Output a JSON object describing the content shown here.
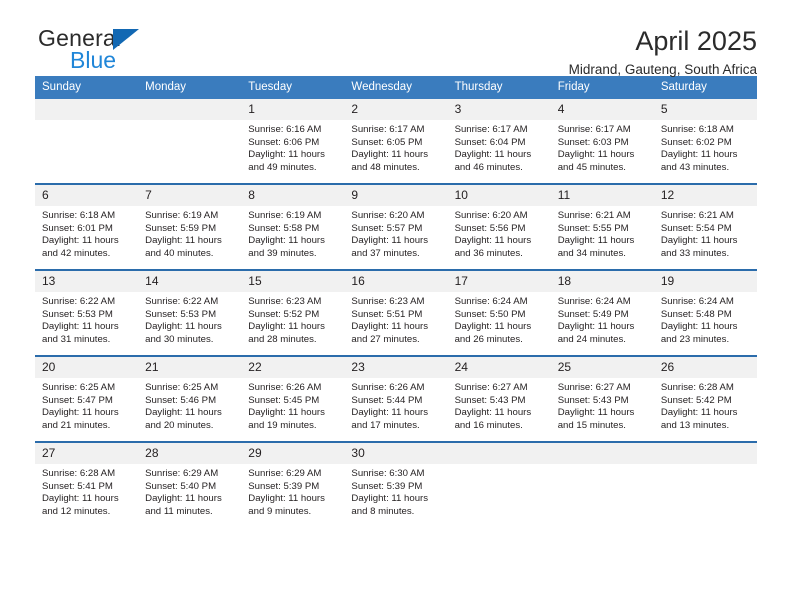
{
  "brand": {
    "name_top": "General",
    "name_bottom": "Blue",
    "accent_color": "#2086d8",
    "triangle_color": "#1268b3"
  },
  "header": {
    "title": "April 2025",
    "subtitle": "Midrand, Gauteng, South Africa"
  },
  "calendar": {
    "header_bg": "#3a7cbe",
    "row_rule_color": "#2b6cab",
    "daynum_bg": "#f1f1f1",
    "weekdays": [
      "Sunday",
      "Monday",
      "Tuesday",
      "Wednesday",
      "Thursday",
      "Friday",
      "Saturday"
    ],
    "weeks": [
      [
        {
          "day": ""
        },
        {
          "day": ""
        },
        {
          "day": "1",
          "sunrise": "Sunrise: 6:16 AM",
          "sunset": "Sunset: 6:06 PM",
          "daylight_line1": "Daylight: 11 hours",
          "daylight_line2": "and 49 minutes."
        },
        {
          "day": "2",
          "sunrise": "Sunrise: 6:17 AM",
          "sunset": "Sunset: 6:05 PM",
          "daylight_line1": "Daylight: 11 hours",
          "daylight_line2": "and 48 minutes."
        },
        {
          "day": "3",
          "sunrise": "Sunrise: 6:17 AM",
          "sunset": "Sunset: 6:04 PM",
          "daylight_line1": "Daylight: 11 hours",
          "daylight_line2": "and 46 minutes."
        },
        {
          "day": "4",
          "sunrise": "Sunrise: 6:17 AM",
          "sunset": "Sunset: 6:03 PM",
          "daylight_line1": "Daylight: 11 hours",
          "daylight_line2": "and 45 minutes."
        },
        {
          "day": "5",
          "sunrise": "Sunrise: 6:18 AM",
          "sunset": "Sunset: 6:02 PM",
          "daylight_line1": "Daylight: 11 hours",
          "daylight_line2": "and 43 minutes."
        }
      ],
      [
        {
          "day": "6",
          "sunrise": "Sunrise: 6:18 AM",
          "sunset": "Sunset: 6:01 PM",
          "daylight_line1": "Daylight: 11 hours",
          "daylight_line2": "and 42 minutes."
        },
        {
          "day": "7",
          "sunrise": "Sunrise: 6:19 AM",
          "sunset": "Sunset: 5:59 PM",
          "daylight_line1": "Daylight: 11 hours",
          "daylight_line2": "and 40 minutes."
        },
        {
          "day": "8",
          "sunrise": "Sunrise: 6:19 AM",
          "sunset": "Sunset: 5:58 PM",
          "daylight_line1": "Daylight: 11 hours",
          "daylight_line2": "and 39 minutes."
        },
        {
          "day": "9",
          "sunrise": "Sunrise: 6:20 AM",
          "sunset": "Sunset: 5:57 PM",
          "daylight_line1": "Daylight: 11 hours",
          "daylight_line2": "and 37 minutes."
        },
        {
          "day": "10",
          "sunrise": "Sunrise: 6:20 AM",
          "sunset": "Sunset: 5:56 PM",
          "daylight_line1": "Daylight: 11 hours",
          "daylight_line2": "and 36 minutes."
        },
        {
          "day": "11",
          "sunrise": "Sunrise: 6:21 AM",
          "sunset": "Sunset: 5:55 PM",
          "daylight_line1": "Daylight: 11 hours",
          "daylight_line2": "and 34 minutes."
        },
        {
          "day": "12",
          "sunrise": "Sunrise: 6:21 AM",
          "sunset": "Sunset: 5:54 PM",
          "daylight_line1": "Daylight: 11 hours",
          "daylight_line2": "and 33 minutes."
        }
      ],
      [
        {
          "day": "13",
          "sunrise": "Sunrise: 6:22 AM",
          "sunset": "Sunset: 5:53 PM",
          "daylight_line1": "Daylight: 11 hours",
          "daylight_line2": "and 31 minutes."
        },
        {
          "day": "14",
          "sunrise": "Sunrise: 6:22 AM",
          "sunset": "Sunset: 5:53 PM",
          "daylight_line1": "Daylight: 11 hours",
          "daylight_line2": "and 30 minutes."
        },
        {
          "day": "15",
          "sunrise": "Sunrise: 6:23 AM",
          "sunset": "Sunset: 5:52 PM",
          "daylight_line1": "Daylight: 11 hours",
          "daylight_line2": "and 28 minutes."
        },
        {
          "day": "16",
          "sunrise": "Sunrise: 6:23 AM",
          "sunset": "Sunset: 5:51 PM",
          "daylight_line1": "Daylight: 11 hours",
          "daylight_line2": "and 27 minutes."
        },
        {
          "day": "17",
          "sunrise": "Sunrise: 6:24 AM",
          "sunset": "Sunset: 5:50 PM",
          "daylight_line1": "Daylight: 11 hours",
          "daylight_line2": "and 26 minutes."
        },
        {
          "day": "18",
          "sunrise": "Sunrise: 6:24 AM",
          "sunset": "Sunset: 5:49 PM",
          "daylight_line1": "Daylight: 11 hours",
          "daylight_line2": "and 24 minutes."
        },
        {
          "day": "19",
          "sunrise": "Sunrise: 6:24 AM",
          "sunset": "Sunset: 5:48 PM",
          "daylight_line1": "Daylight: 11 hours",
          "daylight_line2": "and 23 minutes."
        }
      ],
      [
        {
          "day": "20",
          "sunrise": "Sunrise: 6:25 AM",
          "sunset": "Sunset: 5:47 PM",
          "daylight_line1": "Daylight: 11 hours",
          "daylight_line2": "and 21 minutes."
        },
        {
          "day": "21",
          "sunrise": "Sunrise: 6:25 AM",
          "sunset": "Sunset: 5:46 PM",
          "daylight_line1": "Daylight: 11 hours",
          "daylight_line2": "and 20 minutes."
        },
        {
          "day": "22",
          "sunrise": "Sunrise: 6:26 AM",
          "sunset": "Sunset: 5:45 PM",
          "daylight_line1": "Daylight: 11 hours",
          "daylight_line2": "and 19 minutes."
        },
        {
          "day": "23",
          "sunrise": "Sunrise: 6:26 AM",
          "sunset": "Sunset: 5:44 PM",
          "daylight_line1": "Daylight: 11 hours",
          "daylight_line2": "and 17 minutes."
        },
        {
          "day": "24",
          "sunrise": "Sunrise: 6:27 AM",
          "sunset": "Sunset: 5:43 PM",
          "daylight_line1": "Daylight: 11 hours",
          "daylight_line2": "and 16 minutes."
        },
        {
          "day": "25",
          "sunrise": "Sunrise: 6:27 AM",
          "sunset": "Sunset: 5:43 PM",
          "daylight_line1": "Daylight: 11 hours",
          "daylight_line2": "and 15 minutes."
        },
        {
          "day": "26",
          "sunrise": "Sunrise: 6:28 AM",
          "sunset": "Sunset: 5:42 PM",
          "daylight_line1": "Daylight: 11 hours",
          "daylight_line2": "and 13 minutes."
        }
      ],
      [
        {
          "day": "27",
          "sunrise": "Sunrise: 6:28 AM",
          "sunset": "Sunset: 5:41 PM",
          "daylight_line1": "Daylight: 11 hours",
          "daylight_line2": "and 12 minutes."
        },
        {
          "day": "28",
          "sunrise": "Sunrise: 6:29 AM",
          "sunset": "Sunset: 5:40 PM",
          "daylight_line1": "Daylight: 11 hours",
          "daylight_line2": "and 11 minutes."
        },
        {
          "day": "29",
          "sunrise": "Sunrise: 6:29 AM",
          "sunset": "Sunset: 5:39 PM",
          "daylight_line1": "Daylight: 11 hours",
          "daylight_line2": "and 9 minutes."
        },
        {
          "day": "30",
          "sunrise": "Sunrise: 6:30 AM",
          "sunset": "Sunset: 5:39 PM",
          "daylight_line1": "Daylight: 11 hours",
          "daylight_line2": "and 8 minutes."
        },
        {
          "day": ""
        },
        {
          "day": ""
        },
        {
          "day": ""
        }
      ]
    ]
  }
}
